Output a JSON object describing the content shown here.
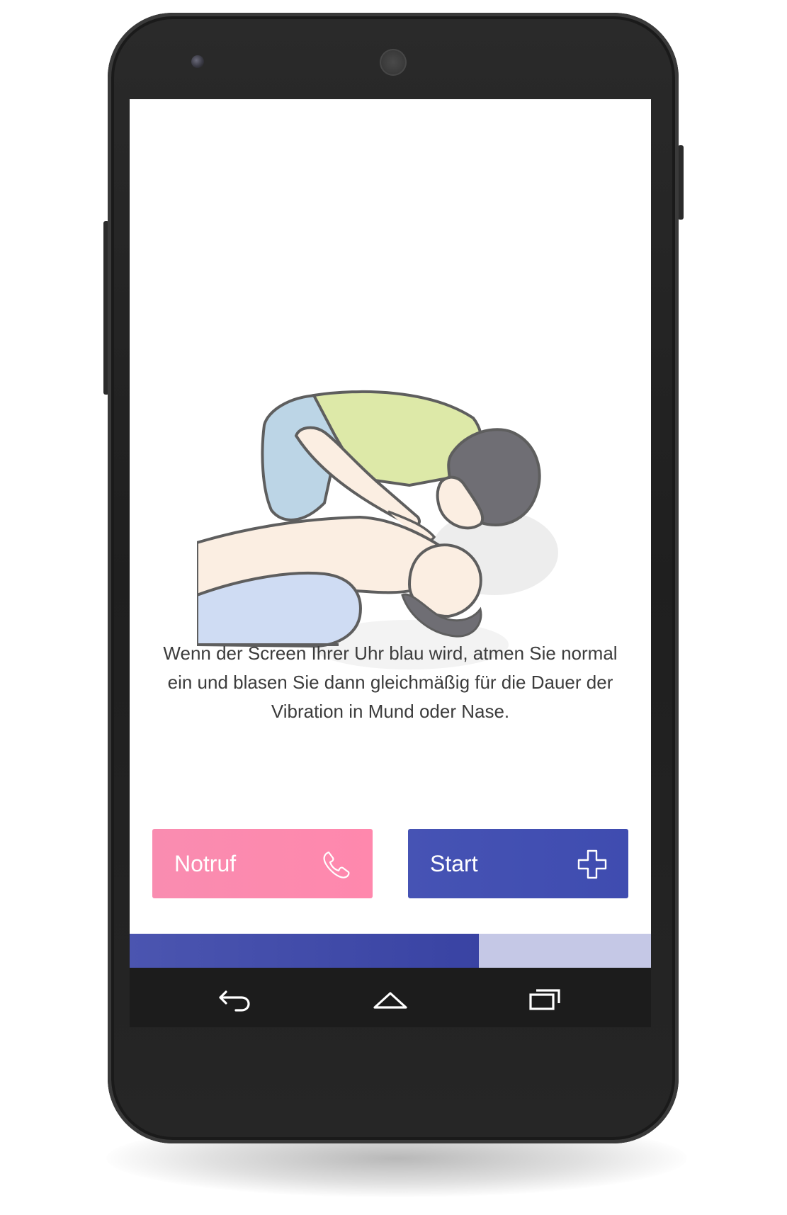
{
  "screen": {
    "instruction": "Wenn der Screen Ihrer Uhr blau wird, atmen Sie normal ein und blasen Sie dann gleichmäßig für die Dauer der Vibration in Mund oder Nase."
  },
  "buttons": {
    "notruf": {
      "label": "Notruf",
      "icon": "phone-icon",
      "color": "#ff88ad"
    },
    "start": {
      "label": "Start",
      "icon": "plus-icon",
      "color": "#4350b2"
    }
  },
  "progress": {
    "value": 0.67,
    "fill_color": "#3b45a5",
    "track_color": "#c5c8e6"
  },
  "navbar": {
    "items": [
      {
        "icon": "back-icon"
      },
      {
        "icon": "home-icon"
      },
      {
        "icon": "recents-icon"
      }
    ]
  }
}
